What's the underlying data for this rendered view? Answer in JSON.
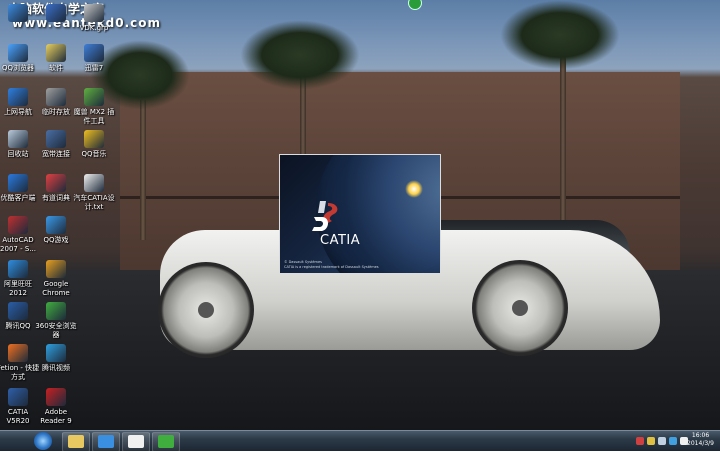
{
  "watermark": {
    "line1": "电脑软件自学之家",
    "line2": "www.eantekd0.com"
  },
  "desktop_icons": [
    {
      "label": "",
      "color": "#3d8be0",
      "name": "network-icon"
    },
    {
      "label": "",
      "color": "#3a6fc8",
      "name": "computer-icon"
    },
    {
      "label": "VDK.grp",
      "color": "#c8c8c8",
      "name": "file-icon"
    },
    {
      "label": "QQ浏览器",
      "color": "#4aa3ff",
      "name": "qq-browser-icon"
    },
    {
      "label": "软件",
      "color": "#e8d060",
      "name": "folder-icon"
    },
    {
      "label": "迅雷7",
      "color": "#3f7fd8",
      "name": "xunlei-icon"
    },
    {
      "label": "上网导航",
      "color": "#2f80e0",
      "name": "ie-icon"
    },
    {
      "label": "临时存放",
      "color": "#a0a0a0",
      "name": "folder-icon"
    },
    {
      "label": "魔兽 MX2 插件工具",
      "color": "#60b040",
      "name": "mx2-icon"
    },
    {
      "label": "回收站",
      "color": "#bcd",
      "name": "recycle-bin-icon"
    },
    {
      "label": "宽带连接",
      "color": "#4a6fa5",
      "name": "broadband-icon"
    },
    {
      "label": "QQ音乐",
      "color": "#f0c020",
      "name": "qq-music-icon"
    },
    {
      "label": "优酷客户端",
      "color": "#2a7be0",
      "name": "youku-icon"
    },
    {
      "label": "有道词典",
      "color": "#e04040",
      "name": "youdao-icon"
    },
    {
      "label": "汽车CATIA设计.txt",
      "color": "#f0f0f0",
      "name": "text-file-icon"
    },
    {
      "label": "AutoCAD 2007 - S...",
      "color": "#c03030",
      "name": "autocad-icon"
    },
    {
      "label": "QQ游戏",
      "color": "#3a9ae8",
      "name": "qq-game-icon"
    },
    {
      "label": "阿里旺旺 2012",
      "color": "#2f8fe0",
      "name": "wangwang-icon"
    },
    {
      "label": "Google Chrome",
      "color": "#e8a020",
      "name": "chrome-icon"
    },
    {
      "label": "腾讯QQ",
      "color": "#2a5fa8",
      "name": "qq-icon"
    },
    {
      "label": "360安全浏览器",
      "color": "#3fae3f",
      "name": "360-browser-icon"
    },
    {
      "label": "Fetion - 快捷方式",
      "color": "#f07020",
      "name": "fetion-icon"
    },
    {
      "label": "腾讯视频",
      "color": "#2fa0e0",
      "name": "tencent-video-icon"
    },
    {
      "label": "CATIA V5R20",
      "color": "#2f5fa8",
      "name": "catia-icon"
    },
    {
      "label": "Adobe Reader 9",
      "color": "#c82020",
      "name": "adobe-reader-icon"
    }
  ],
  "splash": {
    "brand": "CATIA",
    "fine_print_1": "© Dassault Systèmes",
    "fine_print_2": "CATIA is a registered trademark of Dassault Systèmes"
  },
  "taskbar": {
    "clock_time": "16:06",
    "clock_date": "2014/3/9",
    "pinned": [
      {
        "name": "taskbar-explorer-button",
        "color": "#e8c860"
      },
      {
        "name": "taskbar-browser-button",
        "color": "#3a8fe0"
      },
      {
        "name": "taskbar-window-button",
        "color": "#f0f0f0"
      },
      {
        "name": "taskbar-360-button",
        "color": "#3fae3f"
      }
    ],
    "tray_icons": [
      {
        "name": "tray-action-center-icon",
        "color": "#d04040"
      },
      {
        "name": "tray-network-icon",
        "color": "#e0c040"
      },
      {
        "name": "tray-volume-icon",
        "color": "#c0d0e0"
      },
      {
        "name": "tray-app-icon",
        "color": "#40a0e0"
      },
      {
        "name": "tray-flag-icon",
        "color": "#f0f0f0"
      }
    ]
  }
}
